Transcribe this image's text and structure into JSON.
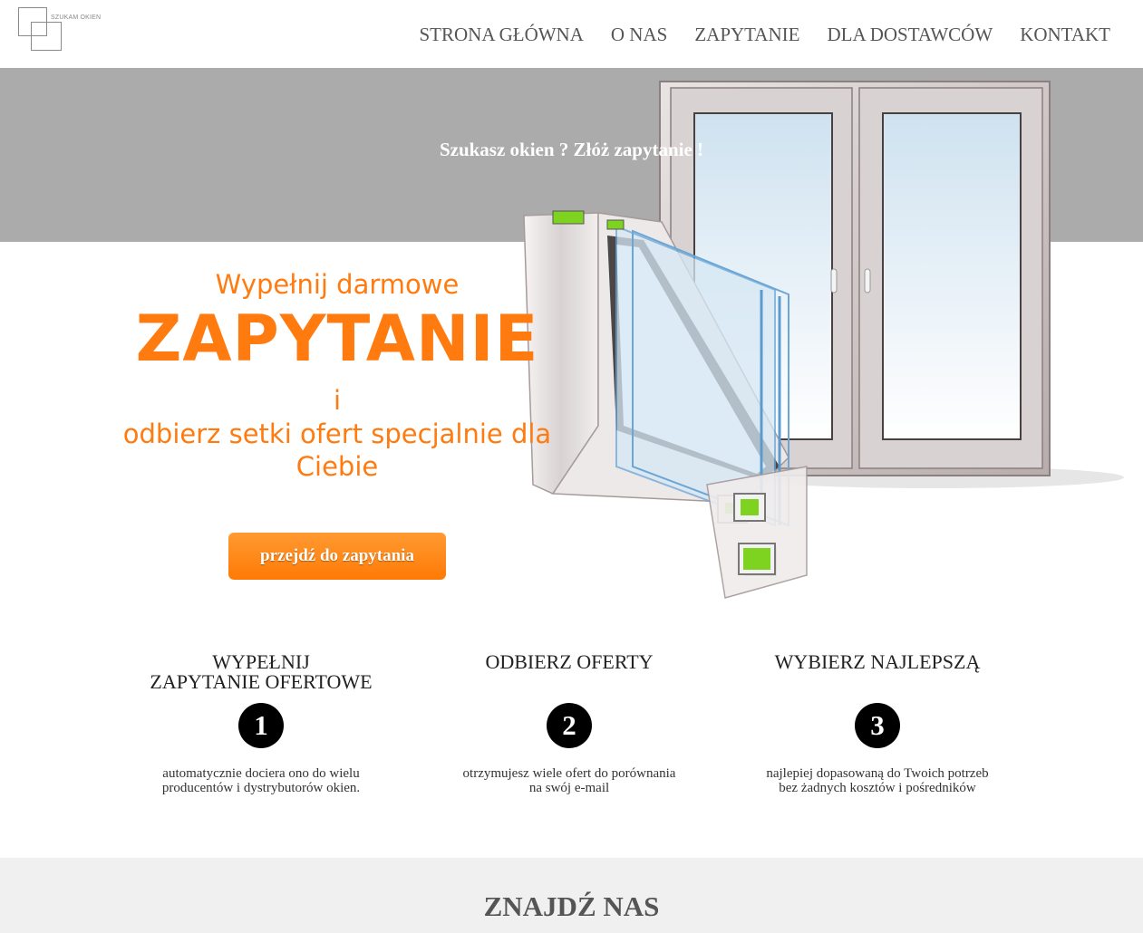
{
  "header": {
    "logo_text": "SZUKAM OKIEN",
    "nav": [
      {
        "label": "STRONA GŁÓWNA"
      },
      {
        "label": "O NAS"
      },
      {
        "label": "ZAPYTANIE"
      },
      {
        "label": "DLA DOSTAWCÓW"
      },
      {
        "label": "KONTAKT"
      }
    ]
  },
  "hero": {
    "banner_text": "Szukasz okien ? Złóż zapytanie !",
    "line1": "Wypełnij darmowe",
    "line2": "ZAPYTANIE",
    "line3": "i",
    "line4a": "odbierz setki ofert specjalnie dla",
    "line4b": "Ciebie",
    "cta_label": "przejdź do zapytania",
    "accent_color": "#ff7b10"
  },
  "steps": [
    {
      "title_a": "WYPEŁNIJ",
      "title_b": "ZAPYTANIE OFERTOWE",
      "number": "1",
      "desc_a": "automatycznie dociera ono do wielu",
      "desc_b": "producentów i dystrybutorów okien."
    },
    {
      "title_a": "ODBIERZ OFERTY",
      "title_b": "",
      "number": "2",
      "desc_a": "otrzymujesz wiele ofert do porównania",
      "desc_b": "na swój e-mail"
    },
    {
      "title_a": "WYBIERZ NAJLEPSZĄ",
      "title_b": "",
      "number": "3",
      "desc_a": "najlepiej dopasowaną do Twoich potrzeb",
      "desc_b": "bez żadnych kosztów i pośredników"
    }
  ],
  "find": {
    "title": "ZNAJDŹ NAS"
  }
}
